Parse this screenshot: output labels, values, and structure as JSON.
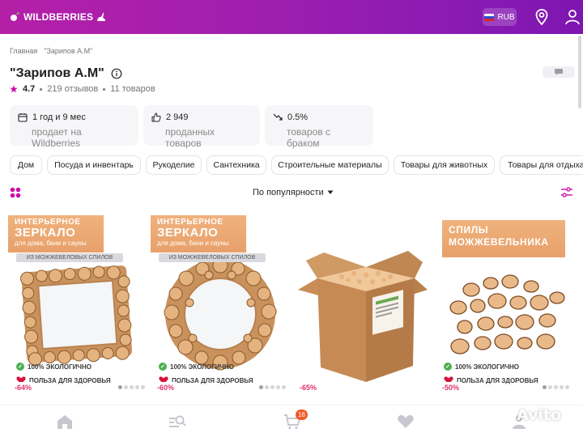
{
  "header": {
    "logo_text": "WILDBERRIES",
    "currency": "RUB",
    "colors": {
      "gradient_start": "#b51fa8",
      "gradient_end": "#7e16b0"
    },
    "icons": [
      "map-pin-icon",
      "user-icon"
    ]
  },
  "breadcrumb": [
    "Главная",
    "\"Зарипов А.М\""
  ],
  "seller": {
    "title": "\"Зарипов А.М\"",
    "rating": "4.7",
    "reviews": "219 отзывов",
    "products": "11 товаров"
  },
  "stats": [
    {
      "icon": "calendar-icon",
      "value": "1 год и 9 мес",
      "caption": "продает на Wildberries"
    },
    {
      "icon": "thumbs-up-icon",
      "value": "2 949",
      "caption": "проданных товаров"
    },
    {
      "icon": "trend-down-icon",
      "value": "0.5%",
      "caption": "товаров с браком"
    }
  ],
  "categories": [
    "Дом",
    "Посуда и инвентарь",
    "Рукоделие",
    "Сантехника",
    "Строительные материалы",
    "Товары для животных",
    "Товары для отдыха"
  ],
  "toolbar": {
    "sort_label": "По популярности"
  },
  "products": [
    {
      "banner_line1": "ИНТЕРЬЕРНОЕ",
      "banner_line2": "ЗЕРКАЛО",
      "banner_line3": "для дома, бани и сауны",
      "subbanner": "ИЗ МОЖЖЕВЕЛОВЫХ СПИЛОВ",
      "eco": "100% ЭКОЛОГИЧНО",
      "health": "ПОЛЬЗА ДЛЯ ЗДОРОВЬЯ",
      "discount": "-64%"
    },
    {
      "banner_line1": "ИНТЕРЬЕРНОЕ",
      "banner_line2": "ЗЕРКАЛО",
      "banner_line3": "для дома, бани и сауны",
      "subbanner": "ИЗ МОЖЖЕВЕЛОВЫХ СПИЛОВ",
      "eco": "100% ЭКОЛОГИЧНО",
      "health": "ПОЛЬЗА ДЛЯ ЗДОРОВЬЯ",
      "discount": "-60%"
    },
    {
      "discount": "-65%"
    },
    {
      "banner_line1": "СПИЛЫ",
      "banner_line2": "МОЖЖЕВЕЛЬНИКА",
      "eco": "100% ЭКОЛОГИЧНО",
      "health": "ПОЛЬЗА ДЛЯ ЗДОРОВЬЯ",
      "discount": "-50%"
    }
  ],
  "bottom_nav": {
    "items": [
      "home-icon",
      "search-catalog-icon",
      "cart-icon",
      "favorites-heart-icon",
      "profile-icon"
    ],
    "cart_count": "16"
  },
  "watermark": "Avito"
}
